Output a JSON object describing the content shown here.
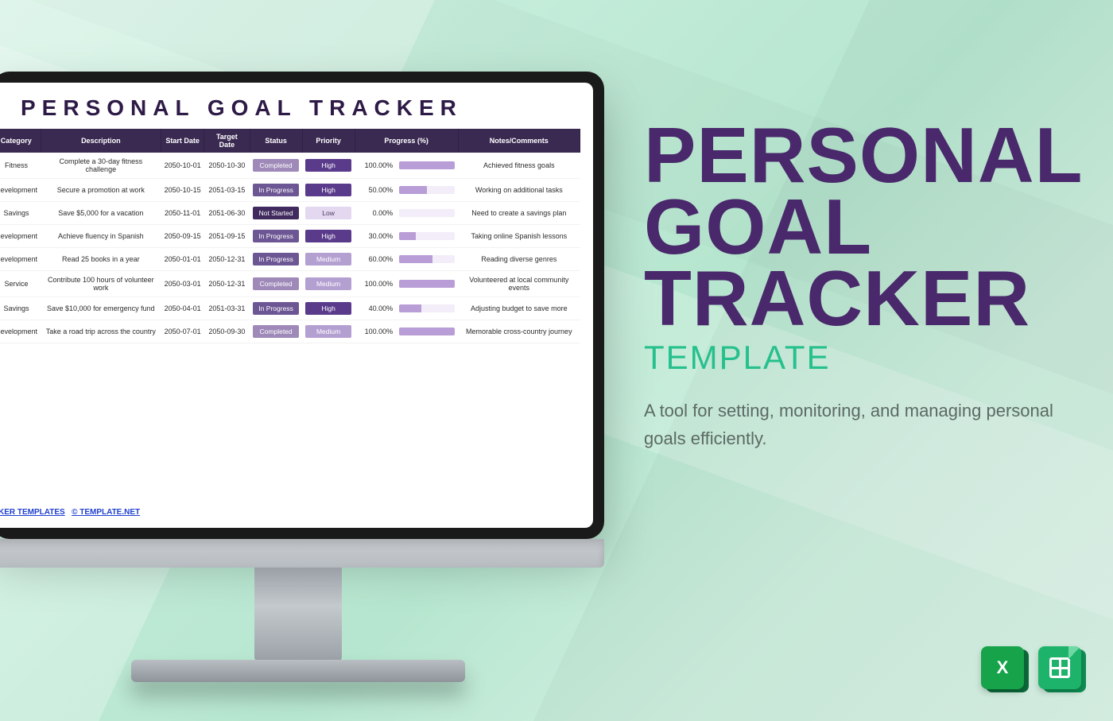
{
  "sheet": {
    "title": "PERSONAL GOAL TRACKER",
    "columns": [
      "Category",
      "Description",
      "Start Date",
      "Target Date",
      "Status",
      "Priority",
      "Progress (%)",
      "Notes/Comments"
    ],
    "rows": [
      {
        "category": "Fitness",
        "description": "Complete a 30-day fitness challenge",
        "start": "2050-10-01",
        "target": "2050-10-30",
        "status": "Completed",
        "priority": "High",
        "progress": 100,
        "notes": "Achieved fitness goals"
      },
      {
        "category": "Development",
        "description": "Secure a promotion at work",
        "start": "2050-10-15",
        "target": "2051-03-15",
        "status": "In Progress",
        "priority": "High",
        "progress": 50,
        "notes": "Working on additional tasks"
      },
      {
        "category": "Savings",
        "description": "Save $5,000 for a vacation",
        "start": "2050-11-01",
        "target": "2051-06-30",
        "status": "Not Started",
        "priority": "Low",
        "progress": 0,
        "notes": "Need to create a savings plan"
      },
      {
        "category": "Development",
        "description": "Achieve fluency in Spanish",
        "start": "2050-09-15",
        "target": "2051-09-15",
        "status": "In Progress",
        "priority": "High",
        "progress": 30,
        "notes": "Taking online Spanish lessons"
      },
      {
        "category": "Development",
        "description": "Read 25 books in a year",
        "start": "2050-01-01",
        "target": "2050-12-31",
        "status": "In Progress",
        "priority": "Medium",
        "progress": 60,
        "notes": "Reading diverse genres"
      },
      {
        "category": "Service",
        "description": "Contribute 100 hours of volunteer work",
        "start": "2050-03-01",
        "target": "2050-12-31",
        "status": "Completed",
        "priority": "Medium",
        "progress": 100,
        "notes": "Volunteered at local community events"
      },
      {
        "category": "Savings",
        "description": "Save $10,000 for emergency fund",
        "start": "2050-04-01",
        "target": "2051-03-31",
        "status": "In Progress",
        "priority": "High",
        "progress": 40,
        "notes": "Adjusting budget to save more"
      },
      {
        "category": "Development",
        "description": "Take a road trip across the country",
        "start": "2050-07-01",
        "target": "2050-09-30",
        "status": "Completed",
        "priority": "Medium",
        "progress": 100,
        "notes": "Memorable cross-country journey"
      }
    ],
    "footer_links": {
      "templates": "KER TEMPLATES",
      "site": "© TEMPLATE.NET"
    }
  },
  "hero": {
    "line1": "PERSONAL",
    "line2": "GOAL",
    "line3": "TRACKER",
    "subtitle": "TEMPLATE",
    "tagline": "A tool for setting, monitoring, and managing personal goals efficiently."
  },
  "formats": {
    "excel": "X",
    "sheets": "Google Sheets"
  }
}
